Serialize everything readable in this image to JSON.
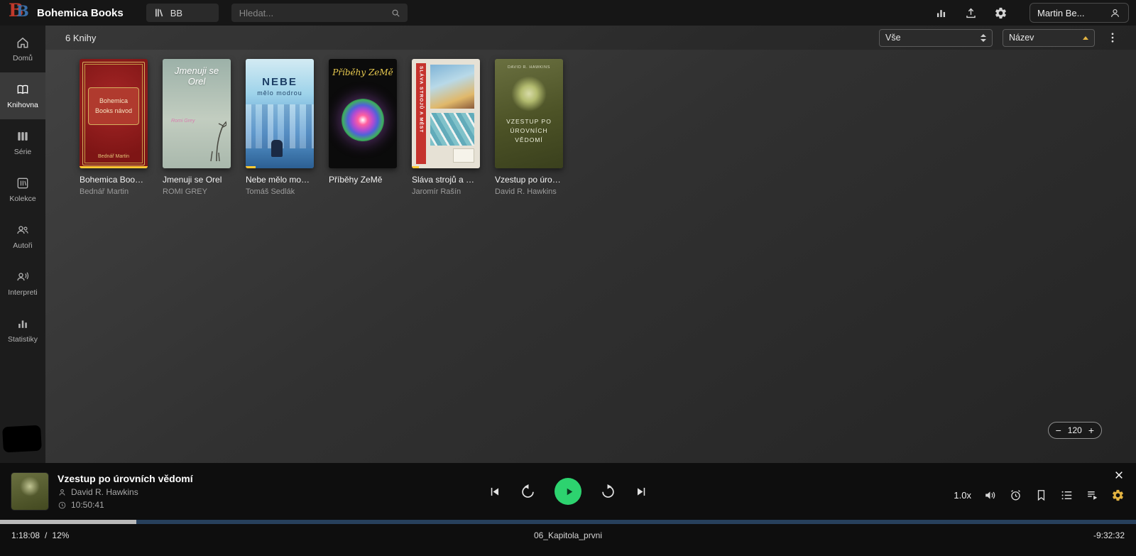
{
  "app": {
    "title": "Bohemica Books",
    "logo_first": "B",
    "logo_second": "B"
  },
  "topbar": {
    "library_label": "BB",
    "search_placeholder": "Hledat...",
    "user_name": "Martin Be..."
  },
  "sidebar": {
    "items": [
      {
        "label": "Domů"
      },
      {
        "label": "Knihovna"
      },
      {
        "label": "Série"
      },
      {
        "label": "Kolekce"
      },
      {
        "label": "Autoři"
      },
      {
        "label": "Interpreti"
      },
      {
        "label": "Statistiky"
      }
    ]
  },
  "toolbar": {
    "count": "6 Knihy",
    "filter": "Vše",
    "sort": "Název"
  },
  "books": [
    {
      "title": "Bohemica Books ...",
      "author": "Bednář Martin",
      "progress_width": "100%",
      "cover": {
        "title": "Bohemica Books návod",
        "author": "Bednář Martin"
      }
    },
    {
      "title": "Jmenuji se Orel",
      "author": "ROMI GREY",
      "progress_width": "0%",
      "cover": {
        "title": "Jmenuji se Orel",
        "author": "Romi Grey"
      }
    },
    {
      "title": "Nebe mělo modrou",
      "author": "Tomáš Sedlák",
      "progress_width": "15%",
      "cover": {
        "title": "NEBE",
        "subtitle": "mělo modrou"
      }
    },
    {
      "title": "Příběhy ZeMě",
      "author": "",
      "progress_width": "0%",
      "cover": {
        "title": "Příběhy ZeMě"
      }
    },
    {
      "title": "Sláva strojů a měst",
      "author": "Jaromír Rašín",
      "progress_width": "10%",
      "cover": {
        "strip": "SLÁVA STROJŮ A MĚST"
      }
    },
    {
      "title": "Vzestup po úrovní...",
      "author": "David R. Hawkins",
      "progress_width": "0%",
      "cover": {
        "author": "DAVID R. HAWKINS",
        "title": "VZESTUP PO ÚROVNÍCH VĚDOMÍ"
      }
    }
  ],
  "zoom": {
    "minus": "−",
    "level": "120",
    "plus": "+"
  },
  "player": {
    "title": "Vzestup po úrovních vědomí",
    "author": "David R. Hawkins",
    "duration": "10:50:41",
    "speed": "1.0x",
    "progress": {
      "width": "12%",
      "elapsed": "1:18:08",
      "sep": "/",
      "percent": "12%",
      "chapter": "06_Kapitola_prvni",
      "remaining": "-9:32:32"
    }
  },
  "colors": {
    "accent_green": "#2dd36f",
    "progress_yellow": "#ffc933",
    "gold_accent": "#e3b341",
    "player_track_blue": "#27405c"
  }
}
